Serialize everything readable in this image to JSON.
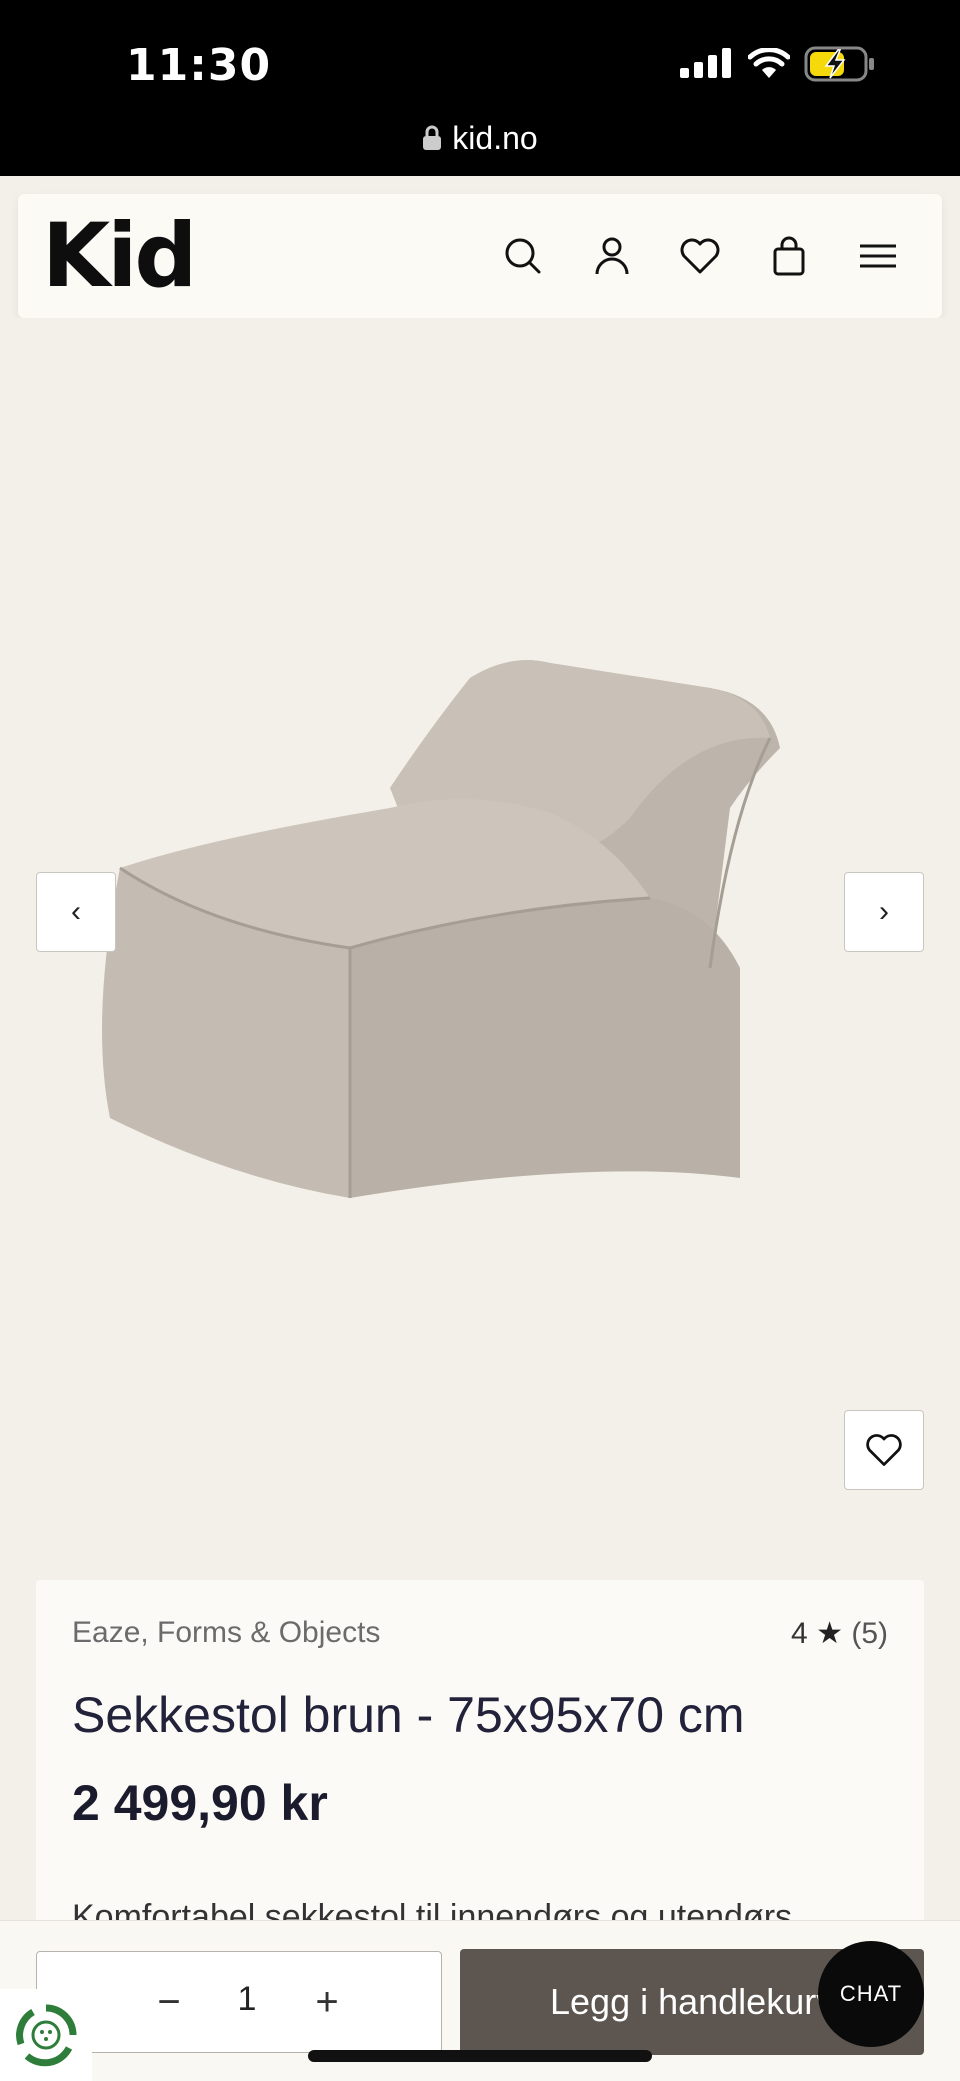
{
  "status_bar": {
    "time": "11:30",
    "url": "kid.no"
  },
  "header": {
    "logo": "Kid",
    "icons": [
      "search-icon",
      "user-icon",
      "heart-icon",
      "bag-icon",
      "menu-icon"
    ]
  },
  "gallery": {
    "prev_label": "‹",
    "next_label": "›"
  },
  "product": {
    "brand": "Eaze, Forms & Objects",
    "rating_value": "4",
    "rating_star": "★",
    "rating_count": "(5)",
    "title": "Sekkestol brun - 75x95x70 cm",
    "price": "2 499,90 kr",
    "description": "Komfortabel sekkestol til innendørs og utendørs"
  },
  "cart_bar": {
    "minus": "−",
    "quantity": "1",
    "plus": "+",
    "add_to_cart": "Legg i handlekurv",
    "chat": "CHAT"
  },
  "colors": {
    "background": "#f3f0e9",
    "button_dark": "#5c5550",
    "text": "#1f1f33"
  }
}
